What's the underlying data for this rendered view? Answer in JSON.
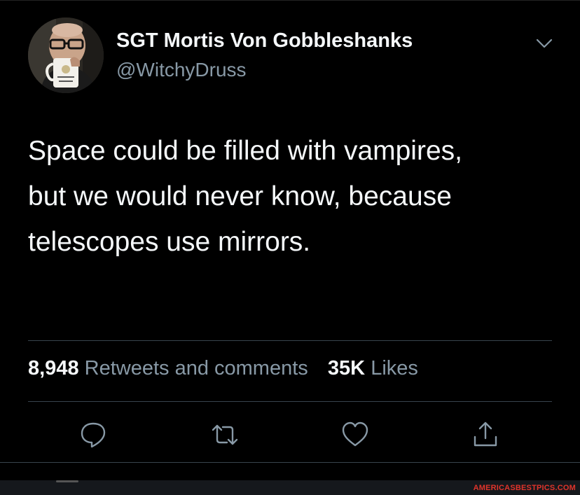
{
  "author": {
    "display_name": "SGT Mortis Von Gobbleshanks",
    "handle": "@WitchyDruss"
  },
  "tweet": {
    "lines": [
      "Space could be filled with vampires,",
      "but we would never know, because",
      "telescopes use mirrors."
    ]
  },
  "stats": {
    "retweets_count": "8,948",
    "retweets_label": "Retweets and comments",
    "likes_count": "35K",
    "likes_label": "Likes"
  },
  "actions": {
    "reply_icon": "reply-icon",
    "retweet_icon": "retweet-icon",
    "like_icon": "heart-icon",
    "share_icon": "share-icon"
  },
  "watermark": "AMERICASBESTPICS.COM",
  "colors": {
    "background": "#000000",
    "primary_text": "#f5f8fa",
    "secondary_text": "#8899a6",
    "divider": "#38444d",
    "watermark": "#e0342b"
  }
}
